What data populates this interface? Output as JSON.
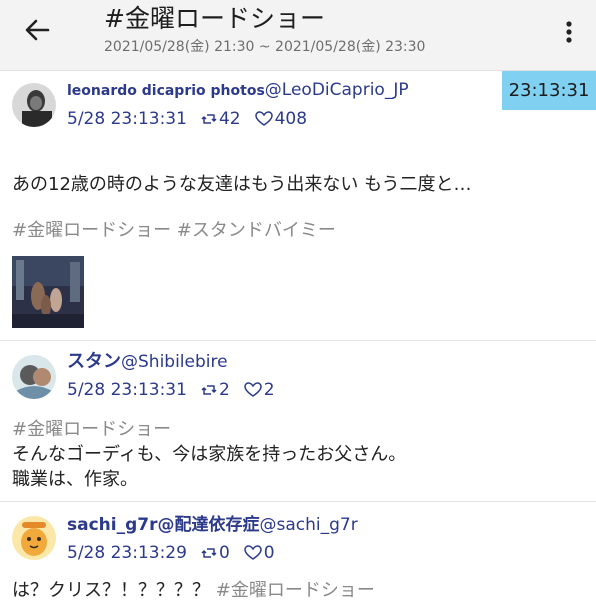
{
  "header": {
    "title": "#金曜ロードショー",
    "range": "2021/05/28(金) 21:30 ~ 2021/05/28(金) 23:30"
  },
  "time_badge": "23:13:31",
  "tweets": [
    {
      "display_name": "leonardo dicaprio photos",
      "screen_name": "@LeoDiCaprio_JP",
      "timestamp": "5/28 23:13:31",
      "retweets": "42",
      "likes": "408",
      "text_line1": "あの12歳の時のような友達はもう出来ない もう二度と…",
      "hashtags": "#金曜ロードショー #スタンドバイミー",
      "avatar_icon": "profile-photo-icon"
    },
    {
      "display_name": "スタン",
      "screen_name": "@Shibilebire",
      "timestamp": "5/28 23:13:31",
      "retweets": "2",
      "likes": "2",
      "hashtag": "#金曜ロードショー",
      "text_line1": "そんなゴーディも、今は家族を持ったお父さん。",
      "text_line2": "職業は、作家。",
      "avatar_icon": "profile-photo-icon"
    },
    {
      "display_name": "sachi_g7r@配達依存症",
      "screen_name": "@sachi_g7r",
      "timestamp": "5/28 23:13:29",
      "retweets": "0",
      "likes": "0",
      "text_prefix": "は？クリス？！？？？？",
      "hashtag": "#金曜ロードショー",
      "avatar_icon": "profile-photo-icon"
    }
  ]
}
